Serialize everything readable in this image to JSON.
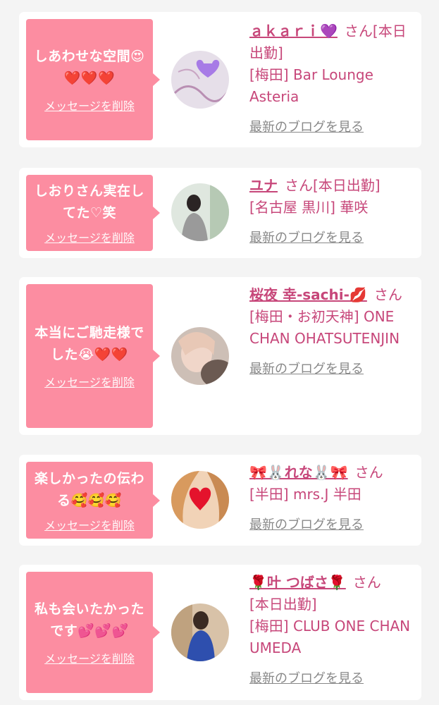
{
  "cards": [
    {
      "message": "しあわせな空間😍❤️❤️❤️",
      "delete_label": "メッセージを削除",
      "name": "ａｋａｒｉ💜",
      "honorific": "さん",
      "status": "[本日出勤]",
      "shop": "[梅田] Bar Lounge Asteria",
      "blog_link": "最新のブログを見る"
    },
    {
      "message": "しおりさん実在してた♡笑",
      "delete_label": "メッセージを削除",
      "name": "ユナ",
      "honorific": "さん",
      "status": "[本日出勤]",
      "shop": "[名古屋 黒川] 華咲",
      "blog_link": "最新のブログを見る"
    },
    {
      "message": "本当にご馳走様でした😭❤️❤️",
      "delete_label": "メッセージを削除",
      "name": "桜夜 幸-sachi-💋",
      "honorific": "さん",
      "status": "",
      "shop": "[梅田・お初天神] ONE CHAN OHATSUTENJIN",
      "blog_link": "最新のブログを見る"
    },
    {
      "message": "楽しかったの伝わる🥰🥰🥰",
      "delete_label": "メッセージを削除",
      "name": "🎀🐰れな🐰🎀",
      "honorific": "さん",
      "status": "",
      "shop": "[半田] mrs.J 半田",
      "blog_link": "最新のブログを見る"
    },
    {
      "message": "私も会いたかったです💕💕💕",
      "delete_label": "メッセージを削除",
      "name": "🌹叶 つばさ🌹",
      "honorific": "さん",
      "status": "[本日出勤]",
      "shop": "[梅田] CLUB ONE CHAN UMEDA",
      "blog_link": "最新のブログを見る"
    }
  ]
}
